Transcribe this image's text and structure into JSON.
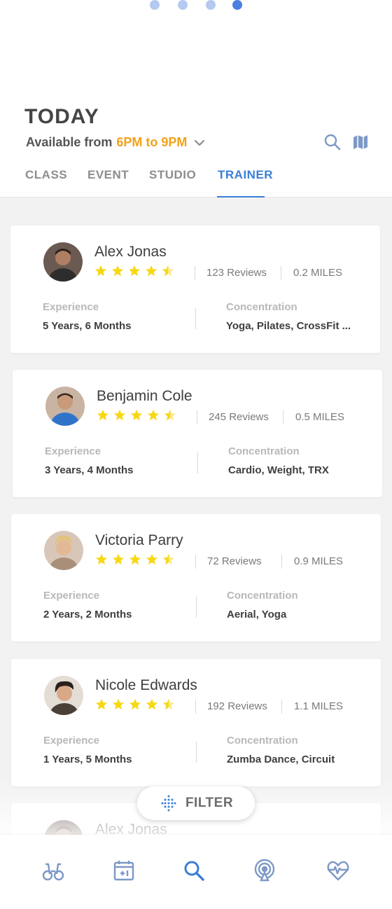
{
  "pager": {
    "count": 4,
    "active_index": 3
  },
  "header": {
    "title": "TODAY",
    "available_prefix": "Available from",
    "available_time": "6PM to 9PM",
    "icons": [
      "search-icon",
      "map-icon",
      "chevron-down-icon"
    ]
  },
  "tabs": [
    {
      "label": "CLASS",
      "active": false
    },
    {
      "label": "EVENT",
      "active": false
    },
    {
      "label": "STUDIO",
      "active": false
    },
    {
      "label": "TRAINER",
      "active": true
    }
  ],
  "labels": {
    "experience": "Experience",
    "concentration": "Concentration"
  },
  "trainers": [
    {
      "name": "Alex Jonas",
      "reviews": "123 Reviews",
      "distance": "0.2 MILES",
      "rating": 4.5,
      "experience": "5 Years, 6 Months",
      "concentration": "Yoga, Pilates, CrossFit ..."
    },
    {
      "name": "Benjamin Cole",
      "reviews": "245 Reviews",
      "distance": "0.5 MILES",
      "rating": 4.5,
      "experience": "3 Years, 4 Months",
      "concentration": "Cardio, Weight, TRX"
    },
    {
      "name": "Victoria Parry",
      "reviews": "72 Reviews",
      "distance": "0.9 MILES",
      "rating": 4.5,
      "experience": "2 Years, 2 Months",
      "concentration": "Aerial, Yoga"
    },
    {
      "name": "Nicole Edwards",
      "reviews": "192 Reviews",
      "distance": "1.1 MILES",
      "rating": 4.5,
      "experience": "1 Years, 5 Months",
      "concentration": "Zumba Dance, Circuit"
    },
    {
      "name": "Alex Jonas"
    }
  ],
  "filter": {
    "label": "FILTER"
  },
  "bottom_nav": [
    {
      "icon": "binoculars-icon",
      "active": false
    },
    {
      "icon": "calendar-plus-icon",
      "active": false
    },
    {
      "icon": "search-icon",
      "active": true
    },
    {
      "icon": "broadcast-icon",
      "active": false
    },
    {
      "icon": "heart-pulse-icon",
      "active": false
    }
  ],
  "colors": {
    "accent": "#3a7ed6",
    "highlight": "#f1a219",
    "star": "#f6d814",
    "inactive": "#8d8d8d",
    "nav_icon": "#7d98c6"
  }
}
